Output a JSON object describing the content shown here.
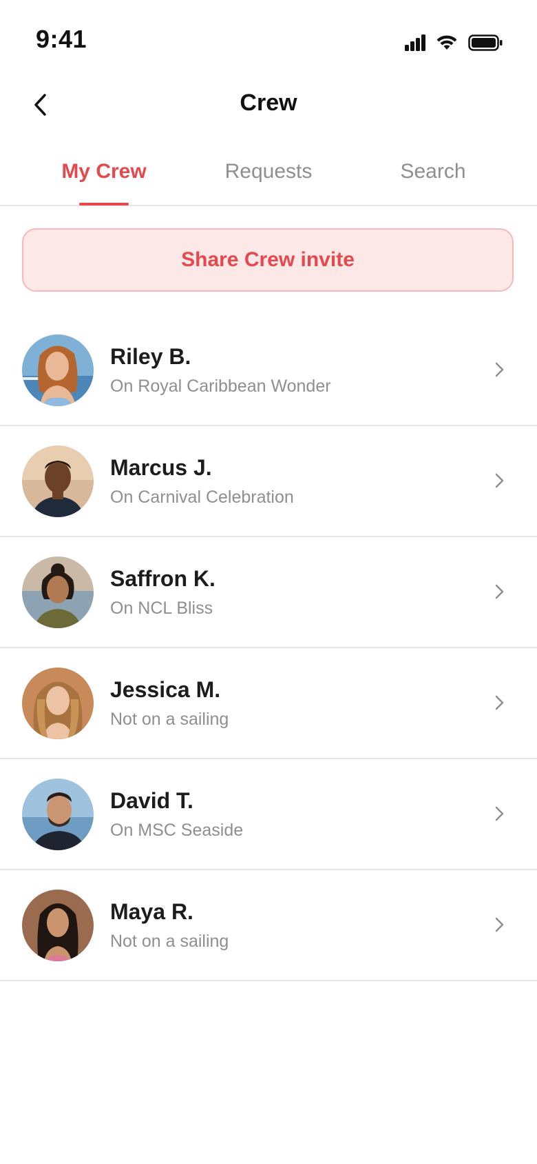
{
  "status_bar": {
    "time": "9:41",
    "icons": [
      "cellular-signal-icon",
      "wifi-icon",
      "battery-icon"
    ]
  },
  "header": {
    "title": "Crew",
    "back_icon": "chevron-left-icon"
  },
  "tabs": [
    {
      "label": "My Crew",
      "active": true
    },
    {
      "label": "Requests",
      "active": false
    },
    {
      "label": "Search",
      "active": false
    }
  ],
  "share_button": {
    "label": "Share Crew invite"
  },
  "crew": [
    {
      "name": "Riley B.",
      "status": "On Royal Caribbean Wonder",
      "avatar": "riley-avatar-photo"
    },
    {
      "name": "Marcus J.",
      "status": "On Carnival Celebration",
      "avatar": "marcus-avatar-photo"
    },
    {
      "name": "Saffron K.",
      "status": "On NCL Bliss",
      "avatar": "saffron-avatar-photo"
    },
    {
      "name": "Jessica M.",
      "status": "Not on a sailing",
      "avatar": "jessica-avatar-photo"
    },
    {
      "name": "David T.",
      "status": "On MSC Seaside",
      "avatar": "david-avatar-photo"
    },
    {
      "name": "Maya R.",
      "status": "Not on a sailing",
      "avatar": "maya-avatar-photo"
    }
  ],
  "colors": {
    "accent": "#e5484d",
    "accent_soft": "#fde8e8",
    "text_primary": "#1c1c1e",
    "text_secondary": "#8e8e93",
    "divider": "#e6e6e6"
  }
}
